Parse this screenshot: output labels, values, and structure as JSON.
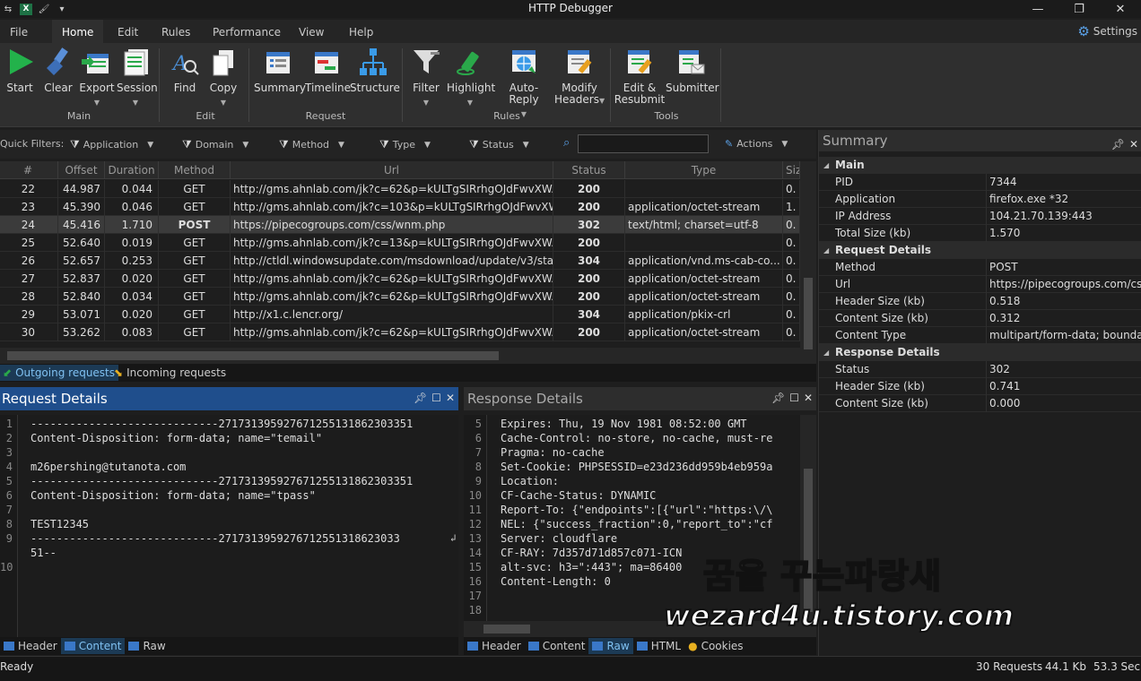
{
  "window": {
    "title": "HTTP Debugger"
  },
  "menu": {
    "tabs": [
      "File",
      "Home",
      "Edit",
      "Rules",
      "Performance",
      "View",
      "Help"
    ],
    "settings": "Settings"
  },
  "ribbon": {
    "buttons": [
      "Start",
      "Clear",
      "Export",
      "Session",
      "Find",
      "Copy",
      "Summary",
      "Timeline",
      "Structure",
      "Filter",
      "Highlight",
      "Auto-Reply",
      "Modify",
      "Headers",
      "Edit &",
      "Resubmit",
      "Submitter"
    ],
    "groups": [
      "Main",
      "Edit",
      "Request",
      "Rules",
      "Tools"
    ]
  },
  "filters": {
    "label": "Quick Filters:",
    "items": [
      "Application",
      "Domain",
      "Method",
      "Type",
      "Status"
    ],
    "actions": "Actions",
    "search": ""
  },
  "grid": {
    "columns": [
      "#",
      "Offset",
      "Duration",
      "Method",
      "Url",
      "Status",
      "Type",
      "Siz"
    ],
    "rows": [
      [
        "22",
        "44.987",
        "0.044",
        "GET",
        "http://gms.ahnlab.com/jk?c=62&p=kULTgSIRrhgOJdFwvXWAt9...",
        "200",
        "",
        "0."
      ],
      [
        "23",
        "45.390",
        "0.046",
        "GET",
        "http://gms.ahnlab.com/jk?c=103&p=kULTgSIRrhgOJdFwvXWAt...",
        "200",
        "application/octet-stream",
        "1."
      ],
      [
        "24",
        "45.416",
        "1.710",
        "POST",
        "https://pipecogroups.com/css/wnm.php",
        "302",
        "text/html; charset=utf-8",
        "0."
      ],
      [
        "25",
        "52.640",
        "0.019",
        "GET",
        "http://gms.ahnlab.com/jk?c=13&p=kULTgSIRrhgOJdFwvXWAt9...",
        "200",
        "",
        "0."
      ],
      [
        "26",
        "52.657",
        "0.253",
        "GET",
        "http://ctldl.windowsupdate.com/msdownload/update/v3/static/...",
        "304",
        "application/vnd.ms-cab-co...",
        "0."
      ],
      [
        "27",
        "52.837",
        "0.020",
        "GET",
        "http://gms.ahnlab.com/jk?c=62&p=kULTgSIRrhgOJdFwvXWAt9...",
        "200",
        "application/octet-stream",
        "0."
      ],
      [
        "28",
        "52.840",
        "0.034",
        "GET",
        "http://gms.ahnlab.com/jk?c=62&p=kULTgSIRrhgOJdFwvXWAt9...",
        "200",
        "application/octet-stream",
        "0."
      ],
      [
        "29",
        "53.071",
        "0.020",
        "GET",
        "http://x1.c.lencr.org/",
        "304",
        "application/pkix-crl",
        "0."
      ],
      [
        "30",
        "53.262",
        "0.083",
        "GET",
        "http://gms.ahnlab.com/jk?c=62&p=kULTgSIRrhgOJdFwvXWAt9...",
        "200",
        "application/octet-stream",
        "0."
      ]
    ]
  },
  "dirtabs": [
    "Outgoing requests",
    "Incoming requests"
  ],
  "request": {
    "title": "Request Details",
    "lines": [
      [
        "1",
        "-----------------------------271731395927671255131862303351"
      ],
      [
        "2",
        "Content-Disposition: form-data; name=\"temail\""
      ],
      [
        "3",
        ""
      ],
      [
        "4",
        "m26pershing@tutanota.com"
      ],
      [
        "5",
        "-----------------------------271731395927671255131862303351"
      ],
      [
        "6",
        "Content-Disposition: form-data; name=\"tpass\""
      ],
      [
        "7",
        ""
      ],
      [
        "8",
        "TEST12345"
      ],
      [
        "9",
        "-----------------------------2717313959276712551318623033"
      ],
      [
        "",
        "51--"
      ],
      [
        "10",
        ""
      ]
    ],
    "tabs": [
      "Header",
      "Content",
      "Raw"
    ]
  },
  "response": {
    "title": "Response Details",
    "lines": [
      [
        "5",
        "Expires: Thu, 19 Nov 1981 08:52:00 GMT"
      ],
      [
        "6",
        "Cache-Control: no-store, no-cache, must-re"
      ],
      [
        "7",
        "Pragma: no-cache"
      ],
      [
        "8",
        "Set-Cookie: PHPSESSID=e23d236dd959b4eb959a"
      ],
      [
        "9",
        "Location:"
      ],
      [
        "10",
        "CF-Cache-Status: DYNAMIC"
      ],
      [
        "11",
        "Report-To: {\"endpoints\":[{\"url\":\"https:\\/\\"
      ],
      [
        "12",
        "NEL: {\"success_fraction\":0,\"report_to\":\"cf"
      ],
      [
        "13",
        "Server: cloudflare"
      ],
      [
        "14",
        "CF-RAY: 7d357d71d857c071-ICN"
      ],
      [
        "15",
        "alt-svc: h3=\":443\"; ma=86400"
      ],
      [
        "16",
        "Content-Length: 0"
      ],
      [
        "17",
        ""
      ],
      [
        "18",
        ""
      ]
    ],
    "tabs": [
      "Header",
      "Content",
      "Raw",
      "HTML",
      "Cookies"
    ]
  },
  "summary": {
    "title": "Summary",
    "rows": [
      {
        "section": "Main"
      },
      {
        "k": "PID",
        "v": "7344"
      },
      {
        "k": "Application",
        "v": "firefox.exe *32"
      },
      {
        "k": "IP Address",
        "v": "104.21.70.139:443"
      },
      {
        "k": "Total Size (kb)",
        "v": "1.570"
      },
      {
        "section": "Request Details"
      },
      {
        "k": "Method",
        "v": "POST"
      },
      {
        "k": "Url",
        "v": "https://pipecogroups.com/css/w"
      },
      {
        "k": "Header Size (kb)",
        "v": "0.518"
      },
      {
        "k": "Content Size (kb)",
        "v": "0.312"
      },
      {
        "k": "Content Type",
        "v": "multipart/form-data; boundary="
      },
      {
        "section": "Response Details"
      },
      {
        "k": "Status",
        "v": "302"
      },
      {
        "k": "Header Size (kb)",
        "v": "0.741"
      },
      {
        "k": "Content Size (kb)",
        "v": "0.000"
      }
    ]
  },
  "status": {
    "left": "Ready",
    "requests": "30 Requests",
    "size": "44.1 Kb",
    "time": "53.3 Sec"
  },
  "watermark": {
    "line1": "꿈을 꾸는파랑새",
    "line2": "wezard4u.tistory.com"
  }
}
